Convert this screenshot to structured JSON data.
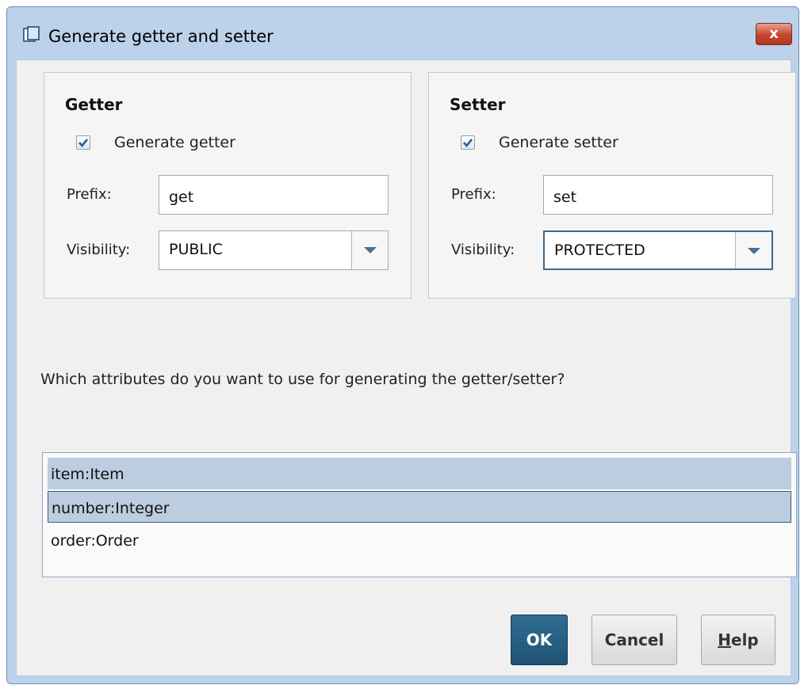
{
  "window": {
    "title": "Generate getter and setter",
    "close_label": "x"
  },
  "getter": {
    "heading": "Getter",
    "checkbox_label": "Generate getter",
    "checked": true,
    "prefix_label": "Prefix:",
    "prefix_value": "get",
    "visibility_label": "Visibility:",
    "visibility_value": "PUBLIC"
  },
  "setter": {
    "heading": "Setter",
    "checkbox_label": "Generate setter",
    "checked": true,
    "prefix_label": "Prefix:",
    "prefix_value": "set",
    "visibility_label": "Visibility:",
    "visibility_value": "PROTECTED"
  },
  "prompt": "Which attributes do you want to use for generating the getter/setter?",
  "attributes": [
    {
      "label": "item:Item",
      "selected": true
    },
    {
      "label": "number:Integer",
      "selected": true,
      "focused": true
    },
    {
      "label": "order:Order",
      "selected": false
    }
  ],
  "buttons": {
    "ok": "OK",
    "cancel": "Cancel",
    "help_mnemonic": "H",
    "help_rest": "elp"
  },
  "colors": {
    "ok_button": "#1f5374",
    "selection": "#bccddf",
    "close_button": "#c4452c"
  },
  "icons": {
    "title": "window-icon",
    "dropdown": "triangle-down-icon",
    "check": "checkmark-icon"
  }
}
